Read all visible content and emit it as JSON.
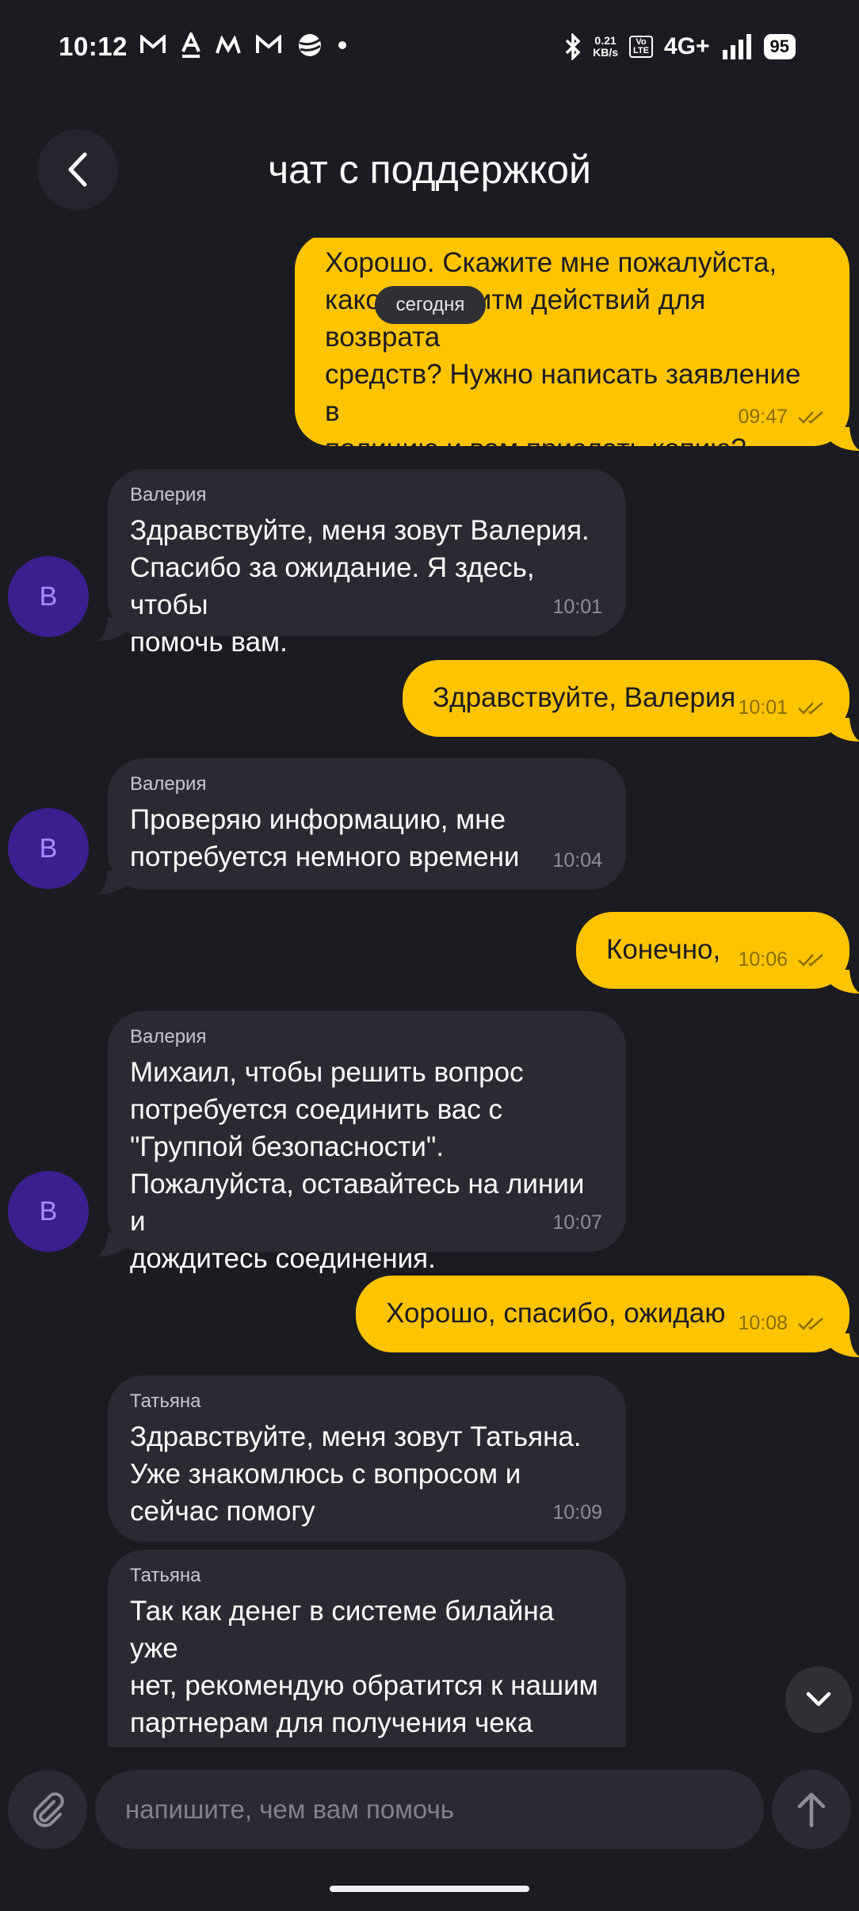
{
  "status_bar": {
    "time": "10:12",
    "speed_value": "0.21",
    "speed_unit": "KB/s",
    "volte_top": "Vo",
    "volte_bottom": "LTE",
    "network": "4G+",
    "battery": "95"
  },
  "header": {
    "title": "чат с поддержкой"
  },
  "date_chip": "сегодня",
  "messages": [
    {
      "direction": "out",
      "text": "Хорошо. Скажите мне пожалуйста,\nкакой алгоритм действий для возврата\nсредств? Нужно написать заявление в\nполицию и вам прислать копию?",
      "time": "09:47"
    },
    {
      "direction": "in",
      "author": "Валерия",
      "avatar": "В",
      "text": "Здравствуйте, меня зовут Валерия.\nСпасибо за ожидание. Я здесь, чтобы\nпомочь вам.",
      "time": "10:01"
    },
    {
      "direction": "out",
      "text": "Здравствуйте, Валерия",
      "time": "10:01"
    },
    {
      "direction": "in",
      "author": "Валерия",
      "avatar": "В",
      "text": "Проверяю информацию, мне\nпотребуется немного времени",
      "time": "10:04"
    },
    {
      "direction": "out",
      "text": "Конечно,",
      "time": "10:06"
    },
    {
      "direction": "in",
      "author": "Валерия",
      "avatar": "В",
      "text": "Михаил, чтобы решить вопрос\nпотребуется соединить вас с\n\"Группой безопасности\".\nПожалуйста, оставайтесь на линии и\nдождитесь соединения.",
      "time": "10:07"
    },
    {
      "direction": "out",
      "text": "Хорошо, спасибо, ожидаю",
      "time": "10:08"
    },
    {
      "direction": "in",
      "author": "Татьяна",
      "text": "Здравствуйте, меня зовут Татьяна.\nУже знакомлюсь с вопросом и\nсейчас помогу",
      "time": "10:09"
    },
    {
      "direction": "in",
      "author": "Татьяна",
      "text": "Так как денег в системе билайна уже\nнет, рекомендую обратится к нашим\nпартнерам для получения чека\nтранзакции. Заранее отмечу что"
    }
  ],
  "composer": {
    "placeholder": "напишите, чем вам помочь"
  },
  "colors": {
    "background": "#1b1c22",
    "outgoing_bubble": "#ffc400",
    "incoming_bubble": "#2a2b32",
    "avatar": "#3b1f8f"
  }
}
